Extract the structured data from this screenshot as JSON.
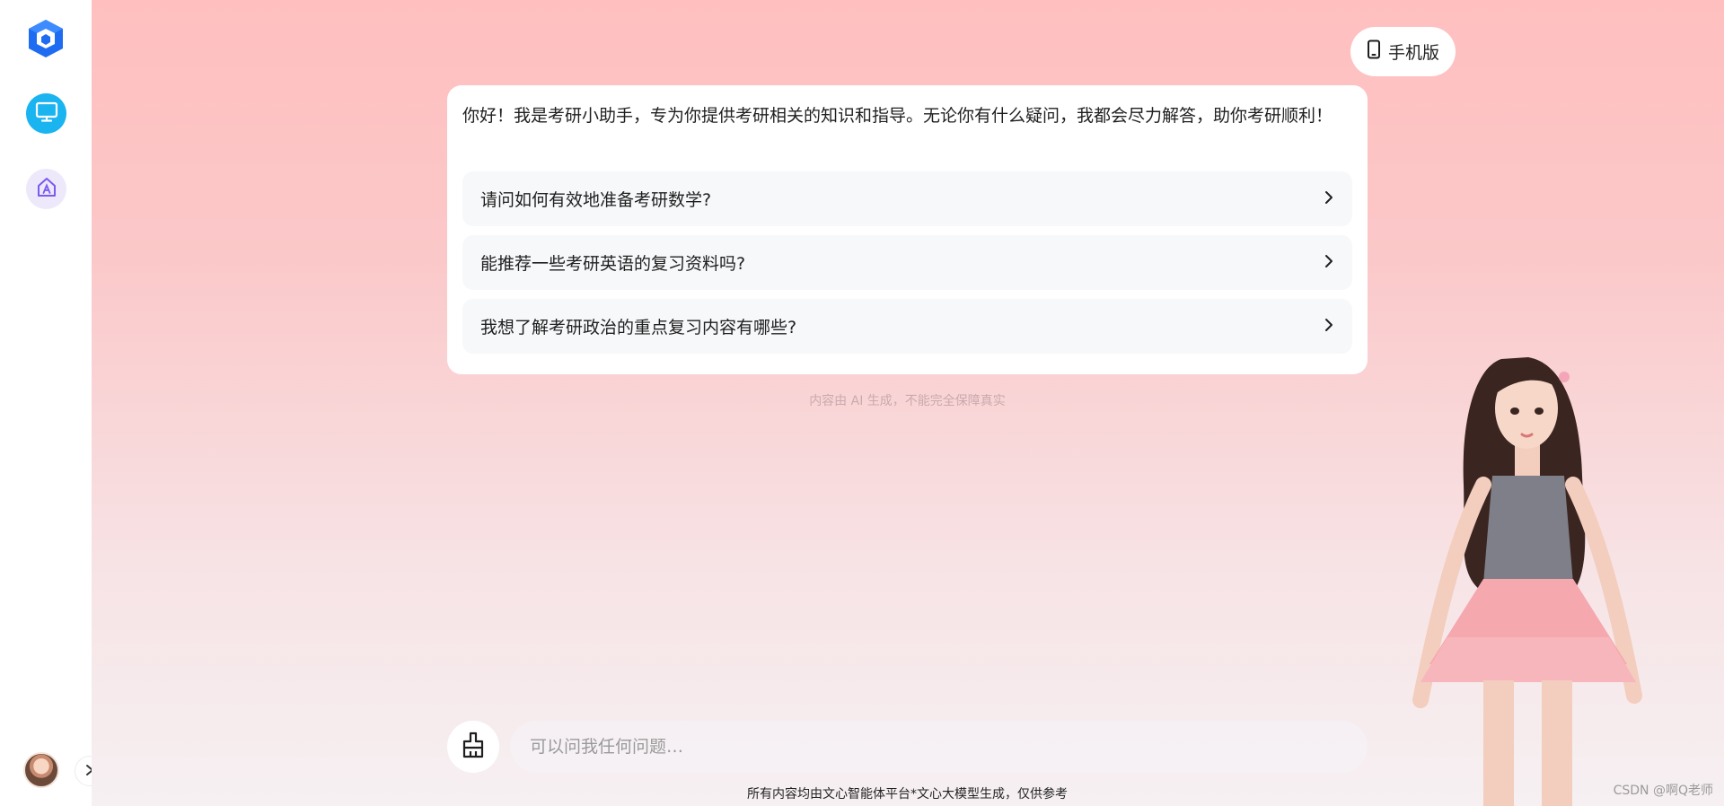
{
  "sidebar": {
    "logo_icon": "wenxin-agent-logo",
    "nav": [
      {
        "icon": "desktop-monitor-icon",
        "active": true,
        "color": "#1ab4f0"
      },
      {
        "icon": "agent-house-icon",
        "active": false,
        "color": "#ede9fb"
      }
    ],
    "avatar_icon": "user-avatar",
    "expand_icon": "chevron-right-icon"
  },
  "header": {
    "mobile_label": "手机版",
    "mobile_icon": "phone-icon"
  },
  "welcome": {
    "text": "你好！我是考研小助手，专为你提供考研相关的知识和指导。无论你有什么疑问，我都会尽力解答，助你考研顺利！",
    "questions": [
      {
        "label": "请问如何有效地准备考研数学?"
      },
      {
        "label": "能推荐一些考研英语的复习资料吗?"
      },
      {
        "label": "我想了解考研政治的重点复习内容有哪些?"
      }
    ]
  },
  "ai_disclaimer": "内容由 AI 生成，不能完全保障真实",
  "composer": {
    "placeholder": "可以问我任何问题…",
    "clear_icon": "broom-icon"
  },
  "footer_note": "所有内容均由文心智能体平台*文心大模型生成，仅供参考",
  "watermark": "CSDN @啊Q老师",
  "colors": {
    "accent": "#1ab4f0",
    "background_top": "#ffbfbf",
    "background_bottom": "#f6f0f2"
  }
}
